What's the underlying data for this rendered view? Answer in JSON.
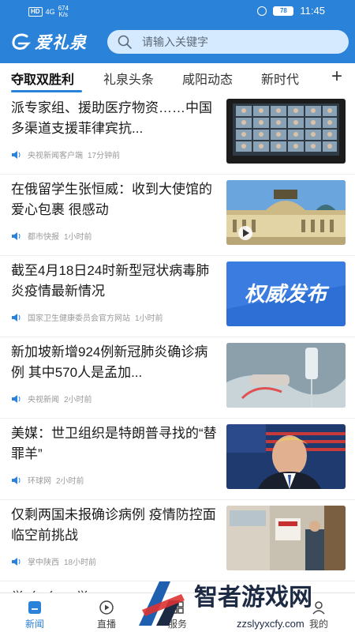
{
  "status_bar": {
    "hd": "HD",
    "signal": "4G",
    "speed_value": "674",
    "speed_unit": "K/s",
    "battery": "78",
    "time": "11:45"
  },
  "header": {
    "logo_text": "爱礼泉",
    "search_placeholder": "请输入关键字"
  },
  "tabs": [
    "夺取双胜利",
    "礼泉头条",
    "咸阳动态",
    "新时代"
  ],
  "news": [
    {
      "title": "派专家组、援助医疗物资……中国多渠道支援菲律宾抗...",
      "source": "央视新闻客户端",
      "time": "17分钟前",
      "thumb": "video-conference"
    },
    {
      "title": "在俄留学生张恒威：收到大使馆的爱心包裹 很感动",
      "source": "都市快报",
      "time": "1小时前",
      "thumb": "palace-building"
    },
    {
      "title": "截至4月18日24时新型冠状病毒肺炎疫情最新情况",
      "source": "国家卫生健康委员会官方网站",
      "time": "1小时前",
      "thumb": "authority-release",
      "thumb_text": "权威发布"
    },
    {
      "title": "新加坡新增924例新冠肺炎确诊病例 其中570人是孟加...",
      "source": "央视新闻",
      "time": "2小时前",
      "thumb": "medical-iv"
    },
    {
      "title": "美媒：世卫组织是特朗普寻找的“替罪羊”",
      "source": "环球网",
      "time": "2小时前",
      "thumb": "press-speaker"
    },
    {
      "title": "仅剩两国未报确诊病例 疫情防控面临空前挑战",
      "source": "掌中陕西",
      "time": "18小时前",
      "thumb": "clinic-entrance"
    }
  ],
  "partial_item_text": "举 么 么 ，举 ",
  "bottom_nav": [
    {
      "label": "新闻",
      "icon": "news-icon",
      "active": true
    },
    {
      "label": "直播",
      "icon": "play-icon",
      "active": false
    },
    {
      "label": "服务",
      "icon": "service-icon",
      "active": false
    },
    {
      "label": "我的",
      "icon": "profile-icon",
      "active": false
    }
  ],
  "watermark": {
    "title": "智者游戏网",
    "url": "zzslyyxcfy.com"
  },
  "colors": {
    "brand_blue": "#2b82d9",
    "search_bg": "#d6eaff",
    "meta_gray": "#9a9a9a"
  }
}
